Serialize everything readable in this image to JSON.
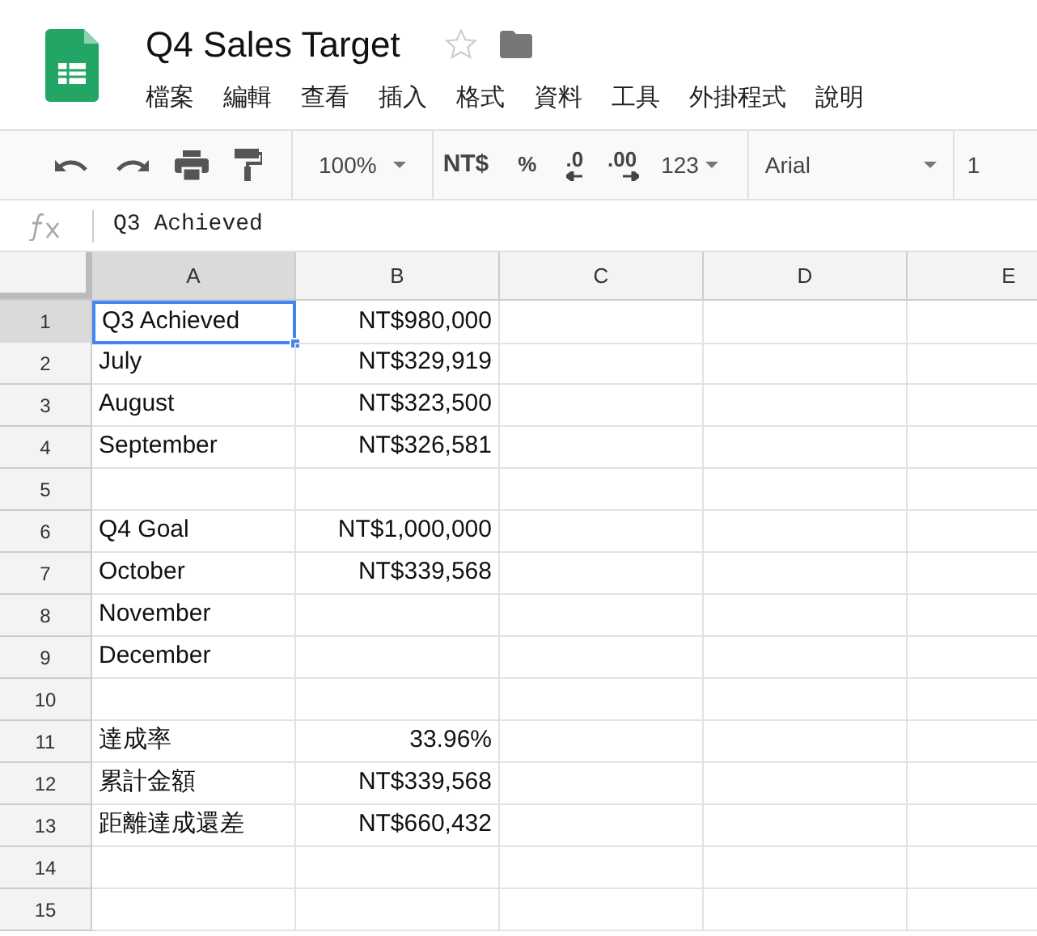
{
  "document": {
    "title": "Q4 Sales Target",
    "starred": false
  },
  "menu": [
    "檔案",
    "編輯",
    "查看",
    "插入",
    "格式",
    "資料",
    "工具",
    "外掛程式",
    "說明"
  ],
  "toolbar": {
    "zoom": "100%",
    "currency": "NT$",
    "percent": "%",
    "decrease_decimals": ".0",
    "increase_decimals": ".00",
    "number_format": "123",
    "font": "Arial",
    "font_size": "1"
  },
  "formula_bar": {
    "value": "Q3 Achieved"
  },
  "columns": [
    {
      "label": "A",
      "selected": true
    },
    {
      "label": "B",
      "selected": false
    },
    {
      "label": "C",
      "selected": false
    },
    {
      "label": "D",
      "selected": false
    },
    {
      "label": "E",
      "selected": false
    }
  ],
  "rows": [
    {
      "number": "1",
      "selected": true,
      "cells": [
        {
          "text": "Q3 Achieved",
          "kind": "text",
          "selected": true
        },
        {
          "text": "NT$980,000",
          "kind": "number",
          "selected": false
        }
      ]
    },
    {
      "number": "2",
      "selected": false,
      "cells": [
        {
          "text": "July",
          "kind": "text",
          "selected": false
        },
        {
          "text": "NT$329,919",
          "kind": "number",
          "selected": false
        }
      ]
    },
    {
      "number": "3",
      "selected": false,
      "cells": [
        {
          "text": "August",
          "kind": "text",
          "selected": false
        },
        {
          "text": "NT$323,500",
          "kind": "number",
          "selected": false
        }
      ]
    },
    {
      "number": "4",
      "selected": false,
      "cells": [
        {
          "text": "September",
          "kind": "text",
          "selected": false
        },
        {
          "text": "NT$326,581",
          "kind": "number",
          "selected": false
        }
      ]
    },
    {
      "number": "5",
      "selected": false,
      "cells": []
    },
    {
      "number": "6",
      "selected": false,
      "cells": [
        {
          "text": "Q4 Goal",
          "kind": "text",
          "selected": false
        },
        {
          "text": "NT$1,000,000",
          "kind": "number",
          "selected": false
        }
      ]
    },
    {
      "number": "7",
      "selected": false,
      "cells": [
        {
          "text": "October",
          "kind": "text",
          "selected": false
        },
        {
          "text": "NT$339,568",
          "kind": "number",
          "selected": false
        }
      ]
    },
    {
      "number": "8",
      "selected": false,
      "cells": [
        {
          "text": "November",
          "kind": "text",
          "selected": false
        }
      ]
    },
    {
      "number": "9",
      "selected": false,
      "cells": [
        {
          "text": "December",
          "kind": "text",
          "selected": false
        }
      ]
    },
    {
      "number": "10",
      "selected": false,
      "cells": []
    },
    {
      "number": "11",
      "selected": false,
      "cells": [
        {
          "text": "達成率",
          "kind": "text",
          "selected": false
        },
        {
          "text": "33.96%",
          "kind": "number",
          "selected": false
        }
      ]
    },
    {
      "number": "12",
      "selected": false,
      "cells": [
        {
          "text": "累計金額",
          "kind": "text",
          "selected": false
        },
        {
          "text": "NT$339,568",
          "kind": "number",
          "selected": false
        }
      ]
    },
    {
      "number": "13",
      "selected": false,
      "cells": [
        {
          "text": "距離達成還差",
          "kind": "text",
          "selected": false
        },
        {
          "text": "NT$660,432",
          "kind": "number",
          "selected": false
        }
      ]
    },
    {
      "number": "14",
      "selected": false,
      "cells": []
    },
    {
      "number": "15",
      "selected": false,
      "cells": []
    }
  ]
}
